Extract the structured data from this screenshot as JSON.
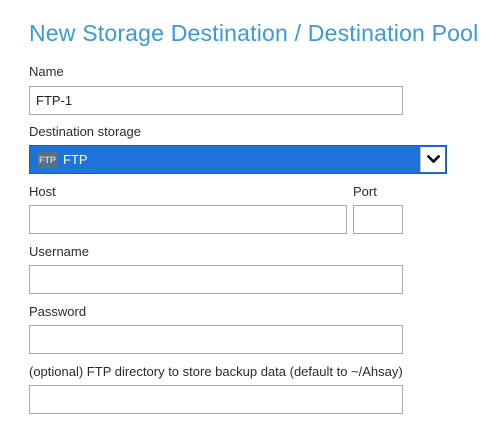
{
  "dialog": {
    "title": "New Storage Destination / Destination Pool"
  },
  "form": {
    "name": {
      "label": "Name",
      "value": "FTP-1"
    },
    "destination_storage": {
      "label": "Destination storage",
      "selected_icon_text": "FTP",
      "selected_value": "FTP",
      "icon": "chevron-down-icon"
    },
    "host": {
      "label": "Host",
      "value": ""
    },
    "port": {
      "label": "Port",
      "value": ""
    },
    "username": {
      "label": "Username",
      "value": ""
    },
    "password": {
      "label": "Password",
      "value": ""
    },
    "ftp_directory": {
      "label": "(optional) FTP directory to store backup data (default to ~/Ahsay)",
      "value": ""
    }
  },
  "colors": {
    "title": "#3a9ad9",
    "select_background": "#1e73d8"
  }
}
